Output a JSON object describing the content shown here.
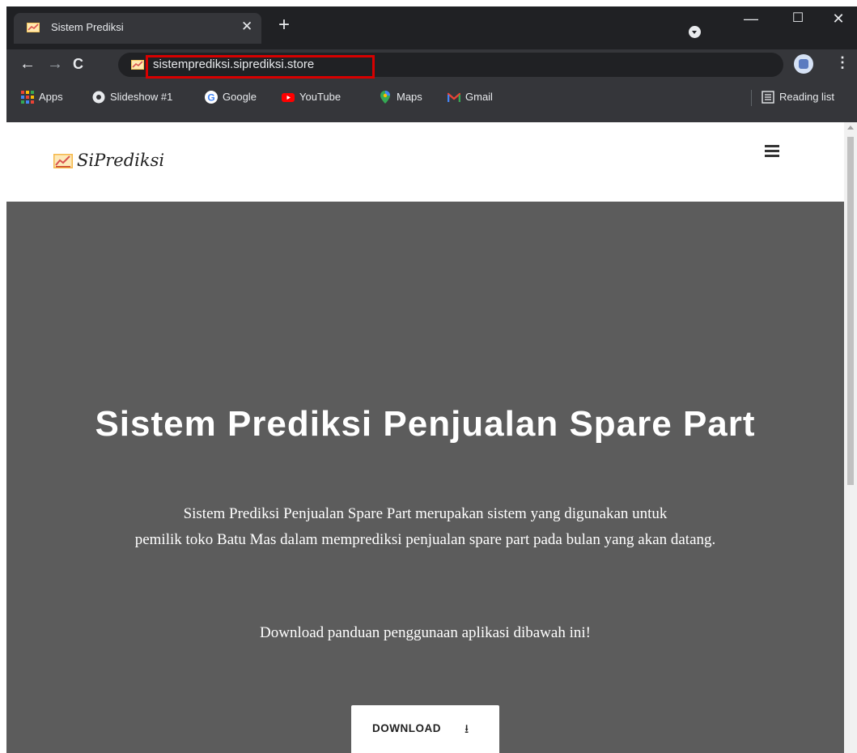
{
  "browser": {
    "tab": {
      "title": "Sistem Prediksi",
      "close": "✕"
    },
    "new_tab": "+",
    "window_controls": {
      "minimize": "—",
      "maximize": "☐",
      "close": "✕"
    },
    "nav": {
      "back": "←",
      "forward": "→",
      "reload": "C"
    },
    "url": "sistemprediksi.siprediksi.store",
    "menu": "⋮",
    "bookmarks": [
      {
        "label": "Apps",
        "icon": "apps-grid-icon"
      },
      {
        "label": "Slideshow #1",
        "icon": "slideshow-icon"
      },
      {
        "label": "Google",
        "icon": "google-icon"
      },
      {
        "label": "YouTube",
        "icon": "youtube-icon"
      },
      {
        "label": "Maps",
        "icon": "maps-icon"
      },
      {
        "label": "Gmail",
        "icon": "gmail-icon"
      }
    ],
    "reading_list": "Reading list"
  },
  "site": {
    "brand": "SiPrediksi",
    "hero": {
      "title": "Sistem Prediksi Penjualan Spare Part",
      "desc_line1": "Sistem Prediksi Penjualan Spare Part merupakan sistem yang digunakan untuk",
      "desc_line2": "pemilik toko Batu Mas dalam memprediksi penjualan spare part pada bulan yang akan datang.",
      "cta": "Download panduan penggunaan aplikasi dibawah ini!",
      "download_label": "DOWNLOAD",
      "download_icon": "⭳"
    }
  },
  "colors": {
    "hero_bg": "#5c5c5c",
    "highlight_box": "#d80000",
    "chrome_dark": "#202124",
    "chrome_toolbar": "#35363a"
  }
}
